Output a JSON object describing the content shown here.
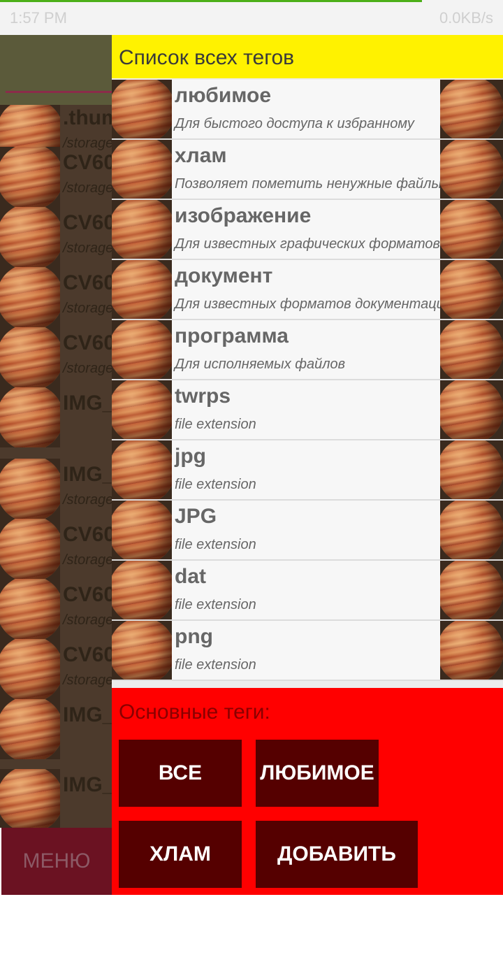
{
  "status_bar": {
    "time": "1:57 PM",
    "right_text": "0.0KB/s"
  },
  "background": {
    "rows": [
      {
        "name": ".thum",
        "path": "/storage"
      },
      {
        "name": "CV60",
        "path": "/storage"
      },
      {
        "name": "CV60",
        "path": "/storage"
      },
      {
        "name": "CV60",
        "path": "/storage"
      },
      {
        "name": "CV60",
        "path": "/storage"
      },
      {
        "name": "IMG_",
        "path": ""
      },
      {
        "name": "IMG_",
        "path": "/storage"
      },
      {
        "name": "CV60",
        "path": "/storage"
      },
      {
        "name": "CV60",
        "path": "/storage"
      },
      {
        "name": "CV60",
        "path": "/storage"
      },
      {
        "name": "IMG_",
        "path": ""
      },
      {
        "name": "IMG_",
        "path": ""
      }
    ],
    "menu_label": "МЕНЮ"
  },
  "drawer": {
    "title": "Список всех тегов",
    "tags": [
      {
        "name": "любимое",
        "desc": "Для быстого доступа к избранному"
      },
      {
        "name": "хлам",
        "desc": "Позволяет пометить ненужные файлы"
      },
      {
        "name": "изображение",
        "desc": "Для известных графических форматов"
      },
      {
        "name": "документ",
        "desc": "Для известных форматов документации"
      },
      {
        "name": "программа",
        "desc": "Для исполняемых файлов"
      },
      {
        "name": "twrps",
        "desc": "file extension"
      },
      {
        "name": "jpg",
        "desc": "file extension"
      },
      {
        "name": "JPG",
        "desc": "file extension"
      },
      {
        "name": "dat",
        "desc": "file extension"
      },
      {
        "name": "png",
        "desc": "file extension"
      }
    ],
    "main_tags_label": "Основные теги:",
    "buttons": {
      "all": "ВСЕ",
      "favorite": "ЛЮБИМОЕ",
      "junk": "ХЛАМ",
      "add_tag": "ДОБАВИТЬ ТЕГ"
    }
  }
}
